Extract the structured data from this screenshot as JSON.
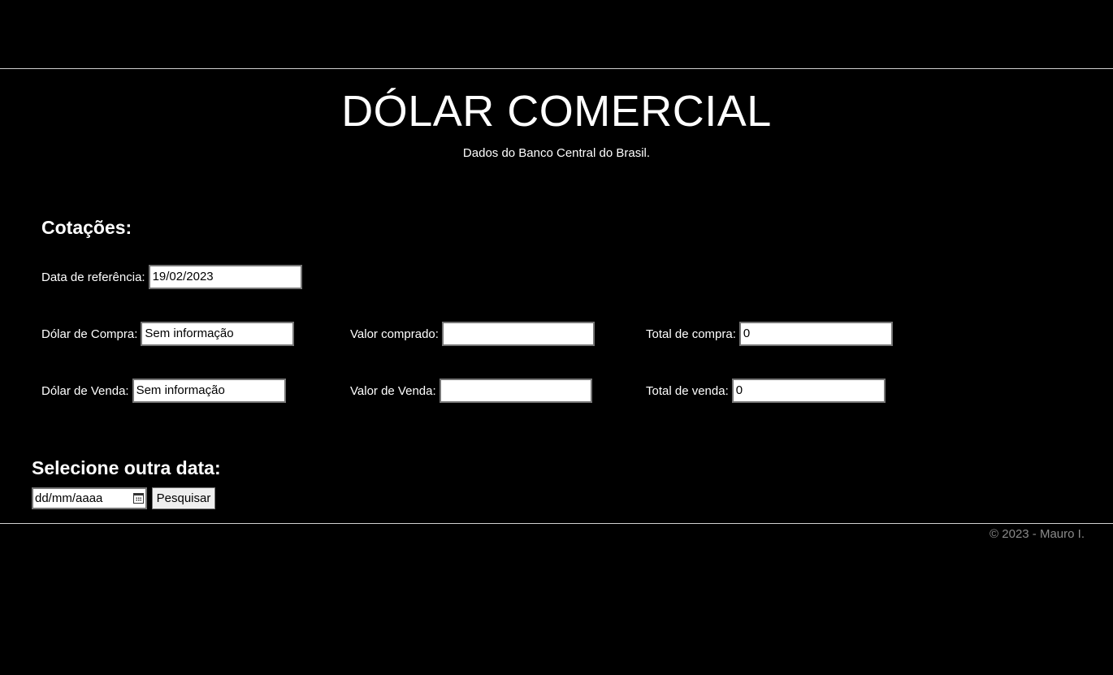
{
  "header": {
    "title": "DÓLAR COMERCIAL",
    "subtitle": "Dados do Banco Central do Brasil."
  },
  "quotes": {
    "heading": "Cotações:",
    "reference_date": {
      "label": "Data de referência:",
      "value": "19/02/2023"
    },
    "buy_rate": {
      "label": "Dólar de Compra:",
      "value": "Sem informação"
    },
    "sell_rate": {
      "label": "Dólar de Venda:",
      "value": "Sem informação"
    },
    "amount_bought": {
      "label": "Valor comprado:",
      "value": ""
    },
    "amount_sold": {
      "label": "Valor de Venda:",
      "value": ""
    },
    "total_buy": {
      "label": "Total de compra:",
      "value": "0"
    },
    "total_sell": {
      "label": "Total de venda:",
      "value": "0"
    }
  },
  "date_search": {
    "heading": "Selecione outra data:",
    "placeholder": "dd/mm/aaaa",
    "button_label": "Pesquisar",
    "calendar_icon": "calendar-icon"
  },
  "footer": {
    "copyright": "© 2023 - Mauro I."
  },
  "colors": {
    "background": "#000000",
    "text": "#ffffff",
    "footer_text": "#8a8a8a",
    "rule": "#cfcfcf"
  }
}
